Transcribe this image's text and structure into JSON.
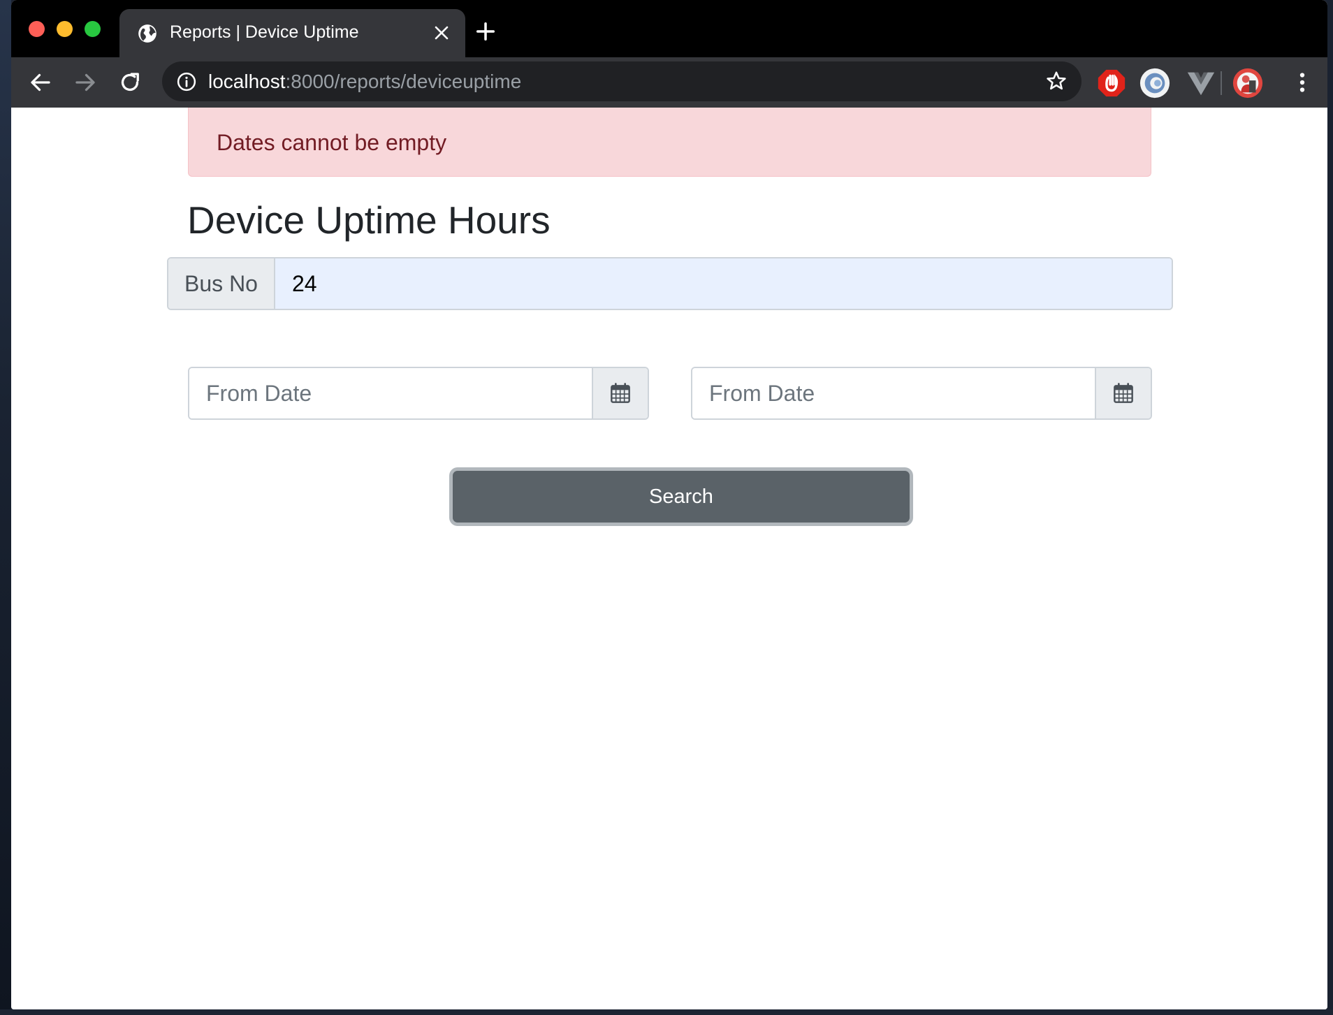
{
  "browser": {
    "tab_title": "Reports | Device Uptime",
    "url_host": "localhost",
    "url_rest": ":8000/reports/deviceuptime"
  },
  "alert": {
    "message": "Dates cannot be empty"
  },
  "page": {
    "title": "Device Uptime Hours"
  },
  "form": {
    "bus_label": "Bus No",
    "bus_value": "24",
    "from_date_placeholder": "From Date",
    "to_date_placeholder": "From Date",
    "search_label": "Search"
  },
  "colors": {
    "alert_bg": "#f8d7da",
    "alert_text": "#721c24",
    "button_bg": "#5a6268",
    "autofill_bg": "#e8f0fe"
  },
  "icons": {
    "tab": "globe-icon",
    "date": "calendar-icon",
    "extensions": [
      "adblock-icon",
      "avatar-extension-icon",
      "vue-devtools-icon"
    ]
  }
}
